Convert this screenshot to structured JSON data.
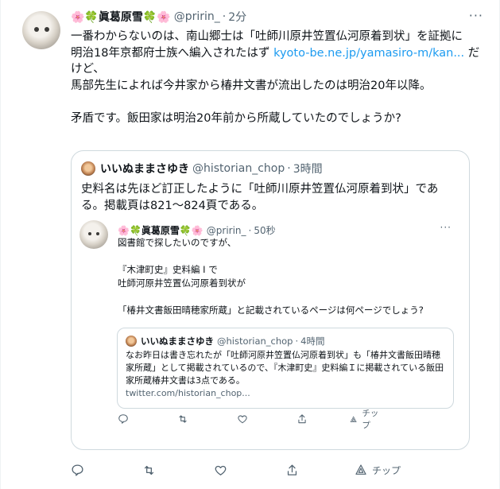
{
  "tweet": {
    "author_name": "🌸🍀眞葛原雪🍀🌸",
    "handle": "@pririn_",
    "separator": "·",
    "time": "2分",
    "more": "···",
    "text_parts": [
      "一番わからないのは、南山郷士は「吐師川原井笠置仏河原着到状」を証拠に\n明治18年京都府士族へ編入されたはず ",
      "kyoto-be.ne.jp/yamasiro-m/kan...",
      " だけど、\n馬部先生によれば今井家から椿井文書が流出したのは明治20年以降。\n\n矛盾です。飯田家は明治20年前から所蔵していたのでしょうか?"
    ],
    "tip_label": "チップ"
  },
  "quote": {
    "author_name": "いいぬままさゆき",
    "handle": "@historian_chop",
    "separator": "·",
    "time": "3時間",
    "text": "史料名は先ほど訂正したように「吐師川原井笠置仏河原着到状」である。掲載頁は821〜824頁である。",
    "inner": {
      "author_name": "🌸🍀眞葛原雪🍀🌸",
      "handle": "@pririn_",
      "separator": "·",
      "time": "50秒",
      "more": "···",
      "text": "図書館で探したいのですが、\n\n『木津町史』史料編 I で\n吐師河原井笠置仏河原着到状が\n\n「椿井文書飯田晴穂家所蔵」と記載されているページは何ページでしょう?",
      "tip_label": "チップ",
      "nested": {
        "author_name": "いいぬままさゆき",
        "handle": "@historian_chop",
        "separator": "·",
        "time": "4時間",
        "text": "なお昨日は書き忘れたが「吐師河原井笠置仏河原着到状」も「椿井文書飯田晴穂家所蔵」として掲載されているので、『木津町史』史料編Ｉに掲載されている飯田家所蔵椿井文書は3点である。",
        "link": "twitter.com/historian_chop..."
      }
    }
  },
  "icons": [
    "reply-icon",
    "retweet-icon",
    "like-icon",
    "share-icon",
    "tip-icon",
    "more-icon"
  ],
  "colors": {
    "link": "#1d9bf0",
    "secondary": "#536471",
    "border": "#cfd9de"
  }
}
